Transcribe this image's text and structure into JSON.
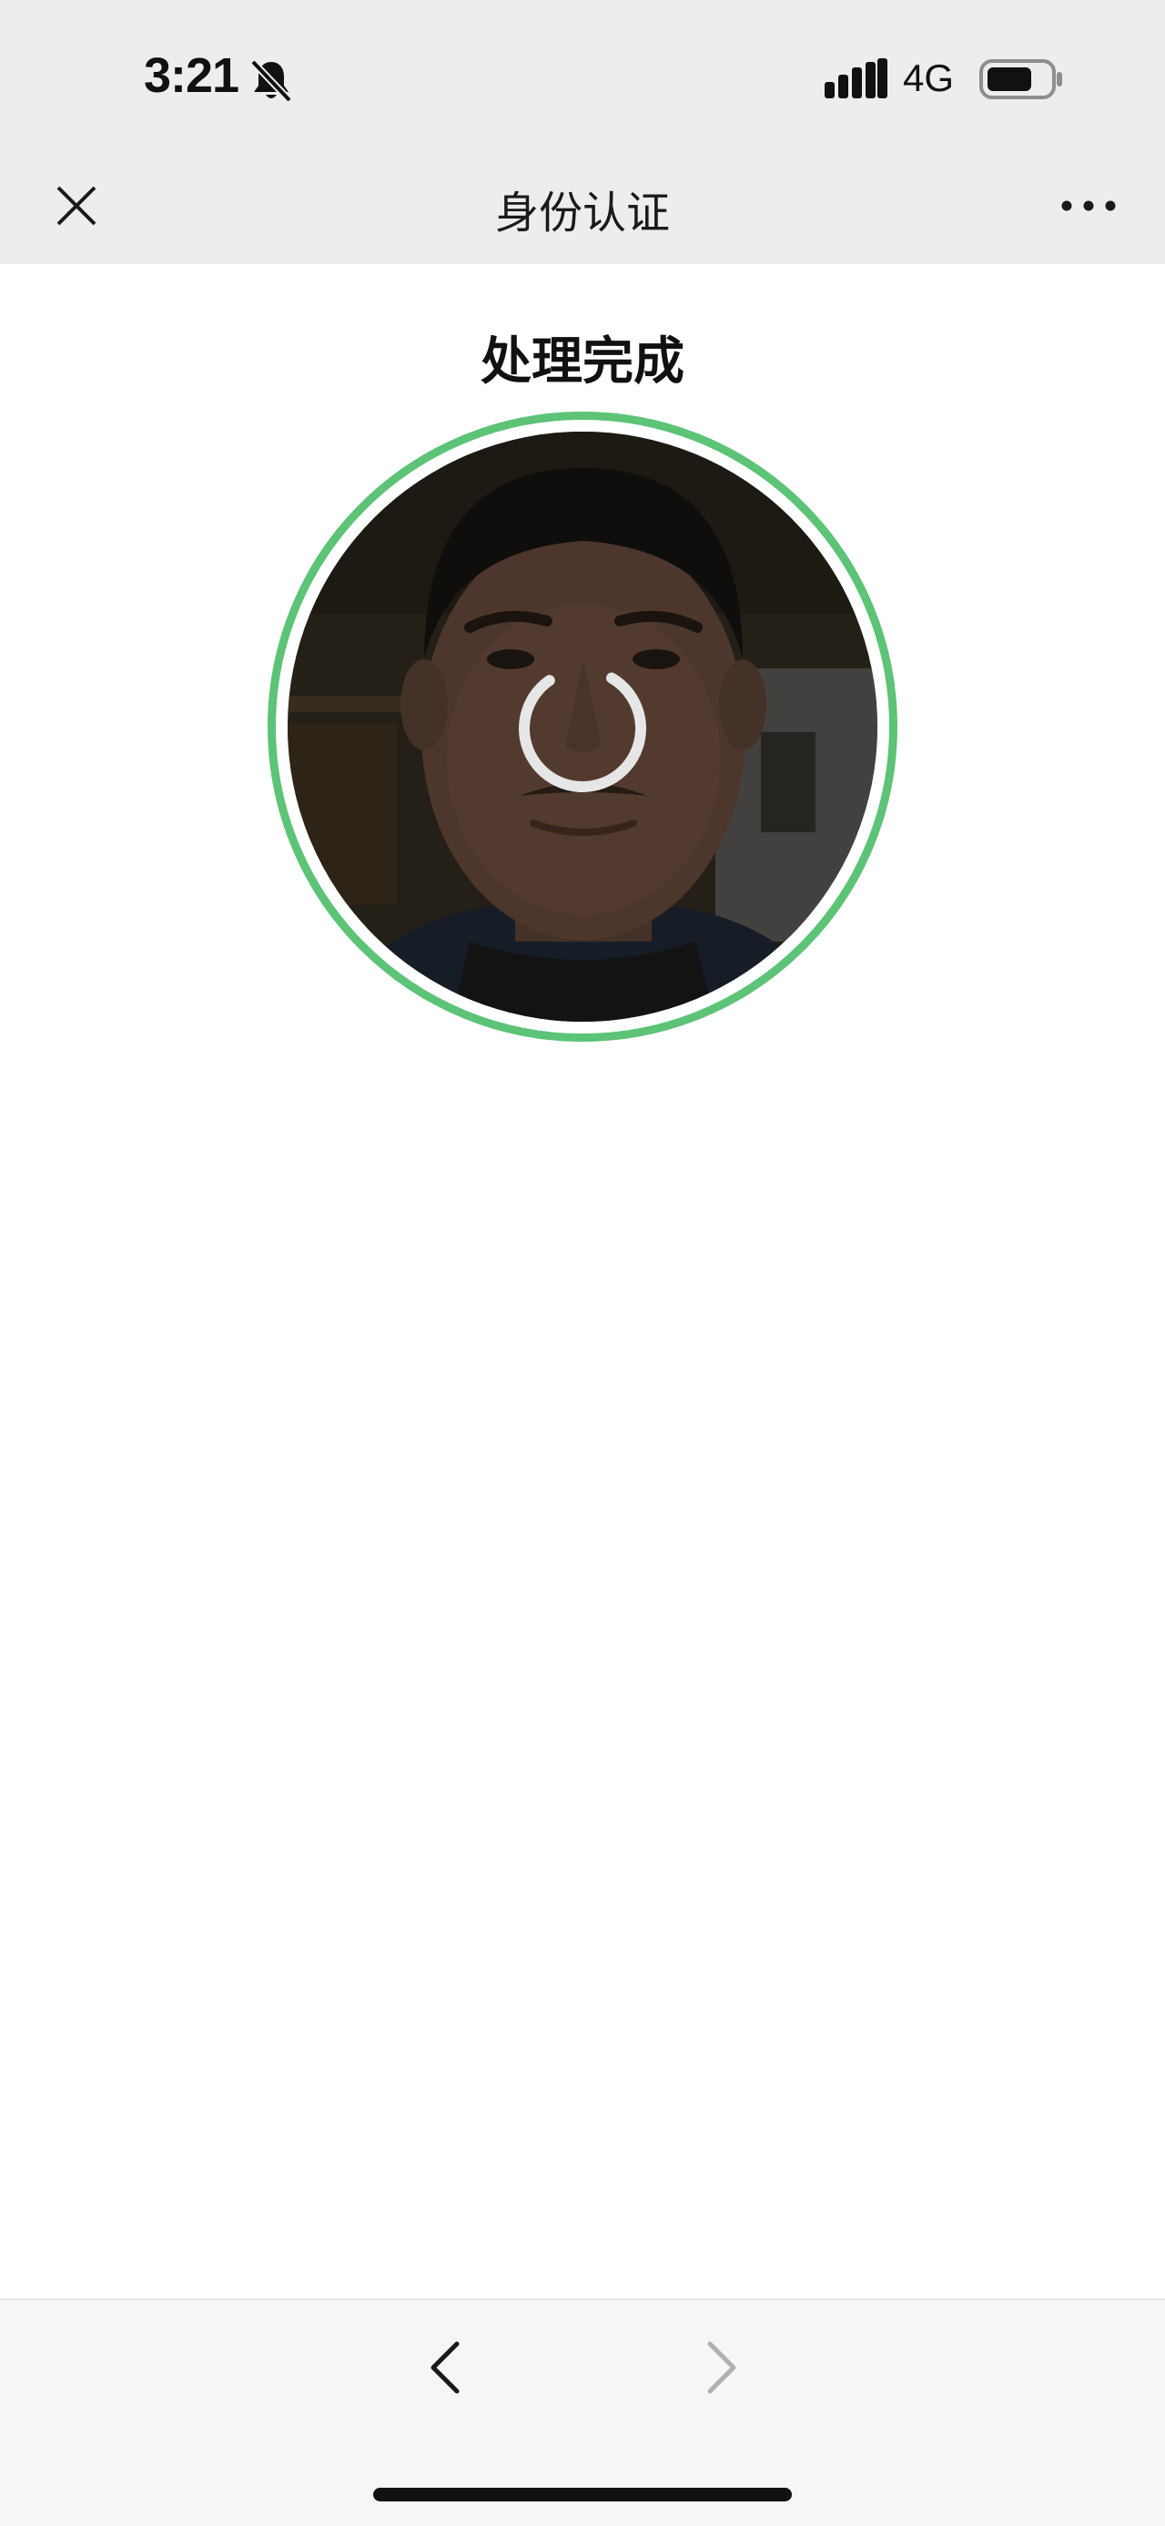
{
  "status_bar": {
    "time": "3:21",
    "network": "4G",
    "icons": [
      "bell-off-icon",
      "signal-icon",
      "battery-icon"
    ]
  },
  "nav": {
    "title": "身份认证",
    "close_icon": "close-icon",
    "more_icon": "more-icon"
  },
  "content": {
    "heading": "处理完成",
    "frame_color": "#5cc377",
    "spinner_icon": "loading-spinner"
  },
  "toolbar": {
    "back_icon": "chevron-left-icon",
    "forward_icon": "chevron-right-icon",
    "forward_enabled": false
  }
}
